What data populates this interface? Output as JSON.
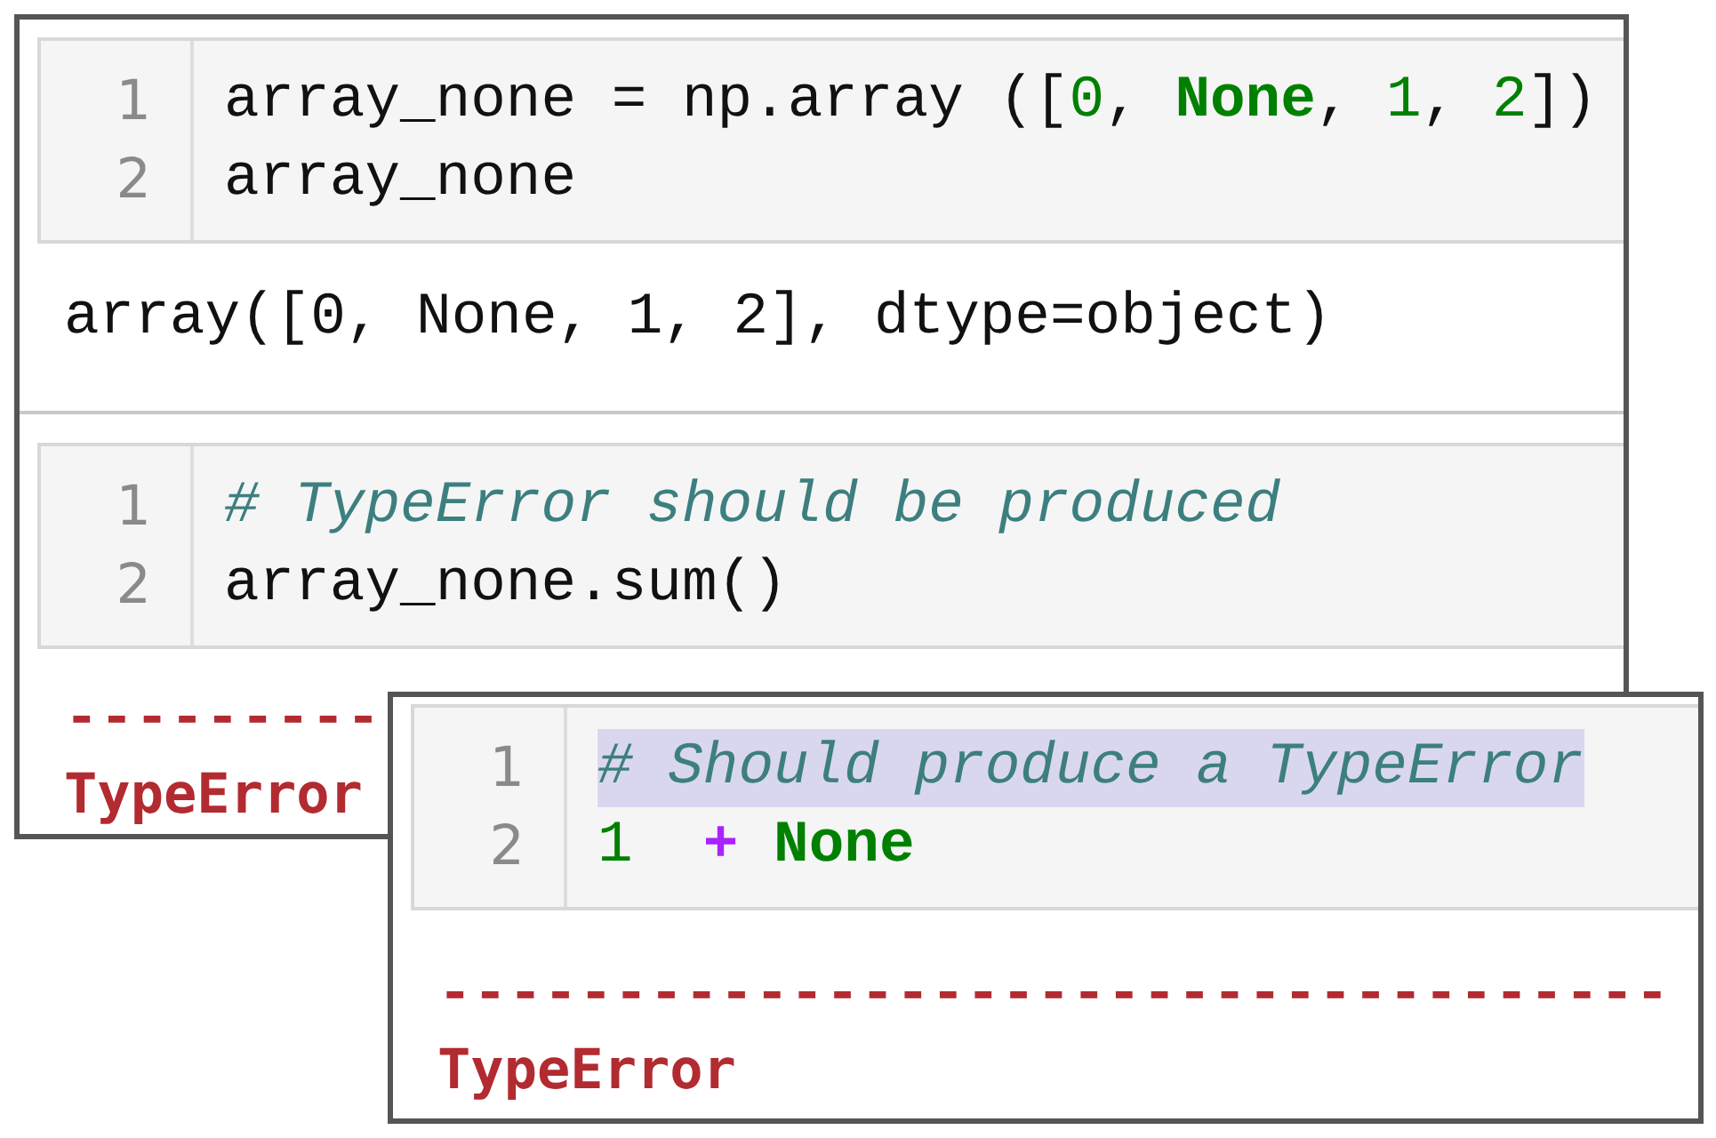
{
  "panels": [
    {
      "cells": [
        {
          "kind": "input",
          "lines": [
            {
              "number": "1",
              "highlighted": false,
              "tokens": [
                {
                  "text": "array_none = np.array ([",
                  "kind": "plain"
                },
                {
                  "text": "0",
                  "kind": "number"
                },
                {
                  "text": ", ",
                  "kind": "plain"
                },
                {
                  "text": "None",
                  "kind": "keyword"
                },
                {
                  "text": ", ",
                  "kind": "plain"
                },
                {
                  "text": "1",
                  "kind": "number"
                },
                {
                  "text": ", ",
                  "kind": "plain"
                },
                {
                  "text": "2",
                  "kind": "number"
                },
                {
                  "text": "])",
                  "kind": "plain"
                }
              ]
            },
            {
              "number": "2",
              "highlighted": false,
              "tokens": [
                {
                  "text": "array_none",
                  "kind": "plain"
                }
              ]
            }
          ]
        },
        {
          "kind": "output",
          "text": "array([0, None, 1, 2], dtype=object)"
        },
        {
          "kind": "input",
          "lines": [
            {
              "number": "1",
              "highlighted": false,
              "tokens": [
                {
                  "text": "# TypeError should be produced",
                  "kind": "comment"
                }
              ]
            },
            {
              "number": "2",
              "highlighted": false,
              "tokens": [
                {
                  "text": "array_none.sum()",
                  "kind": "plain"
                }
              ]
            }
          ]
        },
        {
          "kind": "error",
          "dashes": "---------",
          "name": "TypeError"
        }
      ]
    },
    {
      "cells": [
        {
          "kind": "input",
          "lines": [
            {
              "number": "1",
              "highlighted": true,
              "tokens": [
                {
                  "text": "# Should produce a TypeError",
                  "kind": "comment"
                }
              ]
            },
            {
              "number": "2",
              "highlighted": false,
              "tokens": [
                {
                  "text": "1",
                  "kind": "number"
                },
                {
                  "text": "  +",
                  "kind": "operator"
                },
                {
                  "text": " None",
                  "kind": "keyword"
                }
              ]
            }
          ]
        },
        {
          "kind": "error",
          "dashes": "-----------------------------------",
          "name": "TypeError"
        }
      ]
    }
  ]
}
